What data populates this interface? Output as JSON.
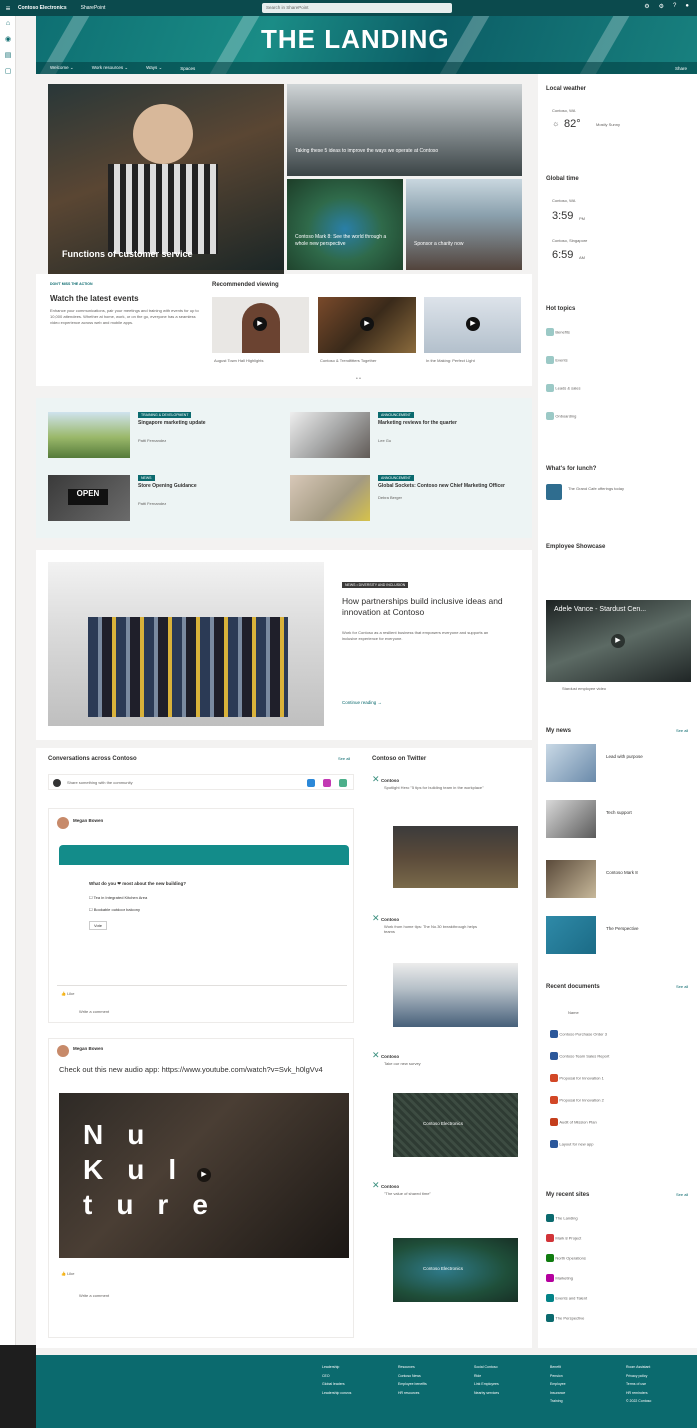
{
  "topbar": {
    "brand": "Contoso Electronics",
    "nav": "SharePoint",
    "search_placeholder": "Search in SharePoint"
  },
  "hero": {
    "title": "THE LANDING",
    "nav": [
      "Welcome ⌄",
      "Work resources ⌄",
      "Ways ⌄",
      "Spaces"
    ],
    "share": "Share"
  },
  "news_hero": {
    "main": "Functions of customer service",
    "top_right": "Taking these 5 ideas to improve the ways we operate at Contoso",
    "bottom_left": "Contoso Mark 8: See the world through a whole new perspective",
    "bottom_right": "Sponsor a charity now"
  },
  "events": {
    "label": "DON'T MISS THE ACTION",
    "title": "Watch the latest events",
    "body": "Enhance your communications, pair your meetings and training with events for up to 10,000 attendees. Whether at home, work, or on the go, everyone has a seamless video experience across web and mobile apps."
  },
  "recommended": {
    "title": "Recommended viewing",
    "videos": [
      "August Town Hall Highlights",
      "Contoso & Trendfitters Together",
      "In the Making: Perfect Light"
    ]
  },
  "news_list": [
    {
      "tag": "TRAINING & DEVELOPMENT",
      "title": "Singapore marketing update",
      "author": "Patti Fernandez"
    },
    {
      "tag": "ANNOUNCEMENT",
      "title": "Marketing reviews for the quarter",
      "author": "Lee Gu"
    },
    {
      "tag": "NEWS",
      "title": "Store Opening Guidance",
      "author": "Patti Fernandez"
    },
    {
      "tag": "ANNOUNCEMENT",
      "title": "Global Sockets: Contoso new Chief Marketing Officer",
      "author": "Debra Berger"
    }
  ],
  "feature": {
    "tag": "NEWS • DIVERSITY AND INCLUSION",
    "title": "How partnerships build inclusive ideas and innovation at Contoso",
    "body": "Work for Contoso as a resilient business that empowers everyone and supports an inclusive experience for everyone.",
    "link": "Continue reading →"
  },
  "conversations": {
    "title": "Conversations across Contoso",
    "see_all": "See all",
    "composer": "Share something with the community",
    "post1_author": "Megan Bowen",
    "poll_question": "What do you ❤ most about the new building?",
    "poll_options": [
      "Tea in Integrated Kitchen Area",
      "Bookable outdoor balcony"
    ],
    "vote": "Vote",
    "reply": "Write a comment",
    "post2_author": "Megan Bowen",
    "post2_text": "Check out this new audio app: https://www.youtube.com/watch?v=Svk_h0lgVv4",
    "video_title": "Nu Kulture"
  },
  "twitter": {
    "title": "Contoso on Twitter",
    "tweets": [
      {
        "name": "Contoso",
        "text": "Spotlight Hero \"5 tips for building team in the workplace\""
      },
      {
        "name": "Contoso",
        "text": "Work from home tips: The No.30 breakthrough helps teams"
      },
      {
        "name": "Contoso",
        "text": "Take our new survey"
      },
      {
        "name": "Contoso",
        "text": "\"The value of shared time\""
      }
    ],
    "image_labels": [
      "Contoso Electronics",
      "Contoso Electronics"
    ]
  },
  "weather": {
    "title": "Local weather",
    "city": "Contoso, WA",
    "temp": "82°",
    "cond": "Mostly Sunny"
  },
  "clock": {
    "title": "Global time",
    "times": [
      {
        "city": "Contoso, WA",
        "time": "3:59",
        "ampm": "PM"
      },
      {
        "city": "Contoso, Singapore",
        "time": "6:59",
        "ampm": "AM"
      }
    ]
  },
  "hot_topics": {
    "title": "Hot topics",
    "items": [
      "Benefits",
      "Events",
      "Leads & sales",
      "Onboarding"
    ]
  },
  "whats_for_lunch": {
    "title": "What's for lunch?",
    "text": "The Grand Cafe offerings today"
  },
  "employee_showcase": {
    "title": "Employee Showcase",
    "video_title": "Adele Vance - Stardust Cen...",
    "caption": "Stardust employee video"
  },
  "my_news": {
    "title": "My news",
    "see_all": "See all",
    "items": [
      "Lead with purpose",
      "Tech support",
      "Contoso Mark 8",
      "The Perspective"
    ]
  },
  "recent_docs": {
    "title": "Recent documents",
    "see_all": "See all",
    "items": [
      "Name",
      "Contoso Purchase Order 3",
      "Contoso Team Sales Report",
      "Proposal for Innovation 1",
      "Proposal for Innovation 2",
      "Audit of Mission Plan",
      "Layout for new app"
    ]
  },
  "recent_sites": {
    "title": "My recent sites",
    "see_all": "See all",
    "items": [
      "The Landing",
      "Mark 8 Project",
      "North Operations",
      "Marketing",
      "Events and Talent",
      "The Perspective"
    ]
  },
  "footer": {
    "cols": [
      [
        "Leadership",
        "CEO",
        "Global leaders",
        "Leadership convos"
      ],
      [
        "Resources",
        "Contoso News",
        "Employee benefits",
        "HR resources"
      ],
      [
        "Social Contoso",
        "Ride",
        "Link Employees",
        "Nearby services"
      ],
      [
        "Benefit",
        "Pension",
        "Employee",
        "Insurance",
        "Training"
      ],
      [
        "Room Assistant",
        "Privacy policy",
        "Terms of use",
        "HR reminders",
        "© 2022 Contoso"
      ]
    ]
  }
}
